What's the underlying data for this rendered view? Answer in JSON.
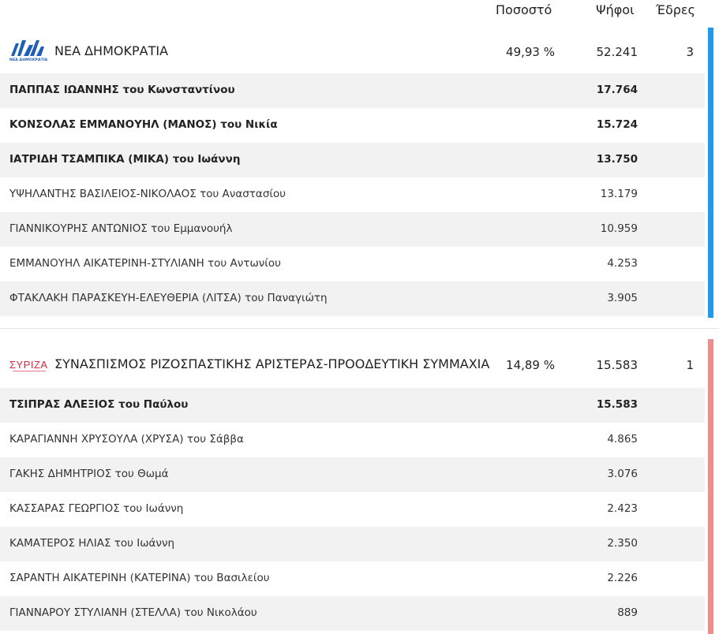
{
  "header": {
    "pct": "Ποσοστό",
    "votes": "Ψήφοι",
    "seats": "Έδρες"
  },
  "parties": [
    {
      "name": "ΝΕΑ ΔΗΜΟΚΡΑΤΙΑ",
      "pct": "49,93 %",
      "votes": "52.241",
      "seats": "3",
      "color": "#1e9bf0",
      "logo_text": "ΝΕΑ ΔΗΜΟΚΡΑΤΙΑ",
      "candidates": [
        {
          "name": "ΠΑΠΠΑΣ ΙΩΑΝΝΗΣ του Κωνσταντίνου",
          "votes": "17.764",
          "elected": true
        },
        {
          "name": "ΚΟΝΣΟΛΑΣ ΕΜΜΑΝΟΥΗΛ (ΜΑΝΟΣ) του Νικία",
          "votes": "15.724",
          "elected": true
        },
        {
          "name": "ΙΑΤΡΙΔΗ ΤΣΑΜΠΙΚΑ (ΜΙΚΑ) του Ιωάννη",
          "votes": "13.750",
          "elected": true
        },
        {
          "name": "ΥΨΗΛΑΝΤΗΣ ΒΑΣΙΛΕΙΟΣ-ΝΙΚΟΛΑΟΣ του Αναστασίου",
          "votes": "13.179",
          "elected": false
        },
        {
          "name": "ΓΙΑΝΝΙΚΟΥΡΗΣ ΑΝΤΩΝΙΟΣ του Εμμανουήλ",
          "votes": "10.959",
          "elected": false
        },
        {
          "name": "ΕΜΜΑΝΟΥΗΛ ΑΙΚΑΤΕΡΙΝΗ-ΣΤΥΛΙΑΝΗ του Αντωνίου",
          "votes": "4.253",
          "elected": false
        },
        {
          "name": "ΦΤΑΚΛΑΚΗ ΠΑΡΑΣΚΕΥΗ-ΕΛΕΥΘΕΡΙΑ (ΛΙΤΣΑ) του Παναγιώτη",
          "votes": "3.905",
          "elected": false
        }
      ]
    },
    {
      "name": "ΣΥΝΑΣΠΙΣΜΟΣ ΡΙΖΟΣΠΑΣΤΙΚΗΣ ΑΡΙΣΤΕΡΑΣ-ΠΡΟΟΔΕΥΤΙΚΗ ΣΥΜΜΑΧΙΑ",
      "pct": "14,89 %",
      "votes": "15.583",
      "seats": "1",
      "color": "#f28b8b",
      "logo_text": "ΣΥΡΙΖΑ",
      "candidates": [
        {
          "name": "ΤΣΙΠΡΑΣ ΑΛΕΞΙΟΣ του Παύλου",
          "votes": "15.583",
          "elected": true
        },
        {
          "name": "ΚΑΡΑΓΙΑΝΝΗ ΧΡΥΣΟΥΛΑ (ΧΡΥΣΑ) του Σάββα",
          "votes": "4.865",
          "elected": false
        },
        {
          "name": "ΓΑΚΗΣ ΔΗΜΗΤΡΙΟΣ του Θωμά",
          "votes": "3.076",
          "elected": false
        },
        {
          "name": "ΚΑΣΣΑΡΑΣ ΓΕΩΡΓΙΟΣ του Ιωάννη",
          "votes": "2.423",
          "elected": false
        },
        {
          "name": "ΚΑΜΑΤΕΡΟΣ ΗΛΙΑΣ του Ιωάννη",
          "votes": "2.350",
          "elected": false
        },
        {
          "name": "ΣΑΡΑΝΤΗ ΑΙΚΑΤΕΡΙΝΗ (ΚΑΤΕΡΙΝΑ) του Βασιλείου",
          "votes": "2.226",
          "elected": false
        },
        {
          "name": "ΓΙΑΝΝΑΡΟΥ ΣΤΥΛΙΑΝΗ (ΣΤΕΛΛΑ) του Νικολάου",
          "votes": "889",
          "elected": false
        }
      ]
    }
  ]
}
